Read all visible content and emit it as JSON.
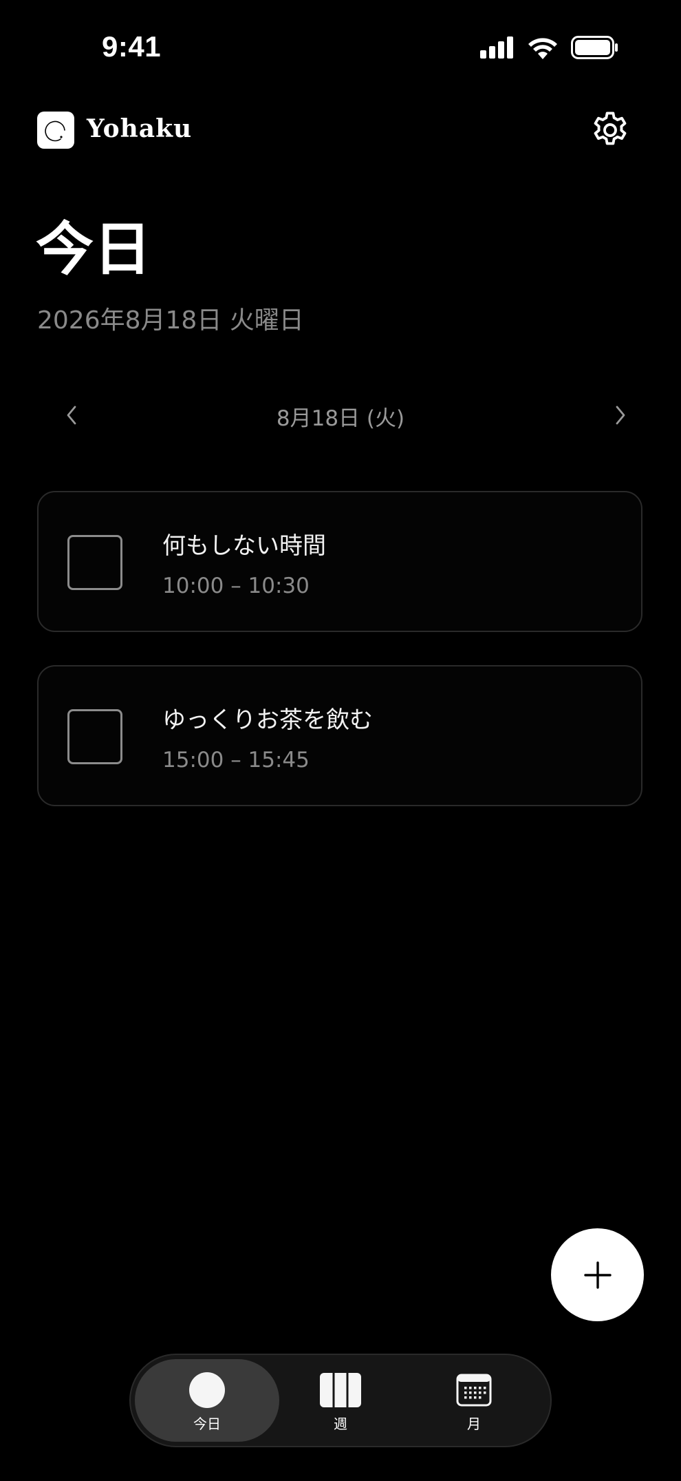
{
  "status_bar": {
    "time": "9:41",
    "icons": [
      "cellular-signal-icon",
      "wifi-icon",
      "battery-icon"
    ]
  },
  "header": {
    "app_name": "Yohaku",
    "logo_icon": "enso-circle-icon",
    "settings_icon": "gear-icon"
  },
  "page": {
    "title": "今日",
    "subtitle": "2026年8月18日 火曜日"
  },
  "date_nav": {
    "label": "8月18日 (火)",
    "prev_icon": "chevron-left-icon",
    "next_icon": "chevron-right-icon"
  },
  "tasks": [
    {
      "title": "何もしない時間",
      "time": "10:00 – 10:30",
      "checked": false
    },
    {
      "title": "ゆっくりお茶を飲む",
      "time": "15:00 – 15:45",
      "checked": false
    }
  ],
  "fab": {
    "icon": "plus-icon"
  },
  "tab_bar": {
    "tabs": [
      {
        "label": "今日",
        "icon": "circle-icon",
        "active": true
      },
      {
        "label": "週",
        "icon": "week-columns-icon",
        "active": false
      },
      {
        "label": "月",
        "icon": "calendar-icon",
        "active": false
      }
    ]
  },
  "colors": {
    "background": "#000000",
    "text_primary": "#ffffff",
    "text_secondary": "#8a8a8a",
    "card_border": "#2a2a2a",
    "active_tab": "#3a3a3a"
  }
}
